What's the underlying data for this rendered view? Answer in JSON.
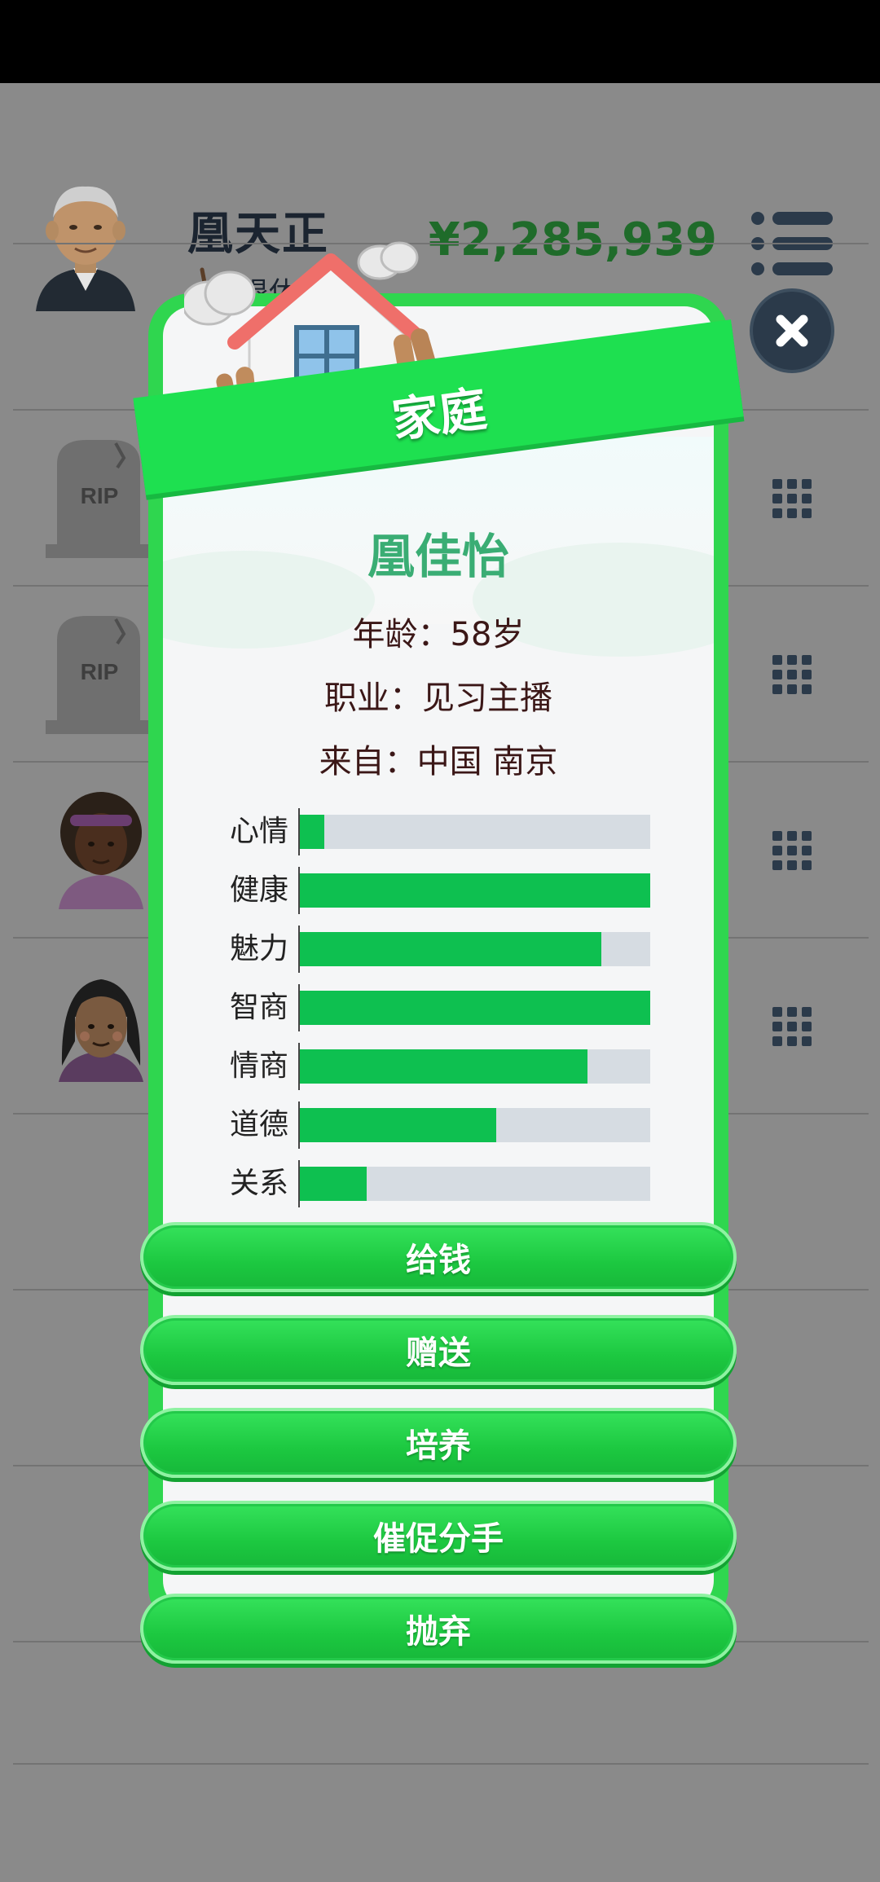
{
  "header": {
    "player_name": "凰天正",
    "status_label": "退休",
    "money": "¥2,285,939"
  },
  "rows": [
    {
      "icon": "tombstone-icon",
      "tombstone_text": "RIP"
    },
    {
      "icon": "tombstone-icon",
      "tombstone_text": "RIP"
    },
    {
      "icon": "avatar-woman-icon"
    },
    {
      "icon": "avatar-girl-icon"
    }
  ],
  "modal": {
    "title": "家庭",
    "name": "凰佳怡",
    "age_line": "年龄：58岁",
    "job_line": "职业：见习主播",
    "from_line": "来自：中国 南京",
    "stats": [
      {
        "label": "心情",
        "value": 0.07
      },
      {
        "label": "健康",
        "value": 1.0
      },
      {
        "label": "魅力",
        "value": 0.86
      },
      {
        "label": "智商",
        "value": 1.0
      },
      {
        "label": "情商",
        "value": 0.82
      },
      {
        "label": "道德",
        "value": 0.56
      },
      {
        "label": "关系",
        "value": 0.19
      }
    ],
    "actions": [
      {
        "label": "给钱"
      },
      {
        "label": "赠送"
      },
      {
        "label": "培养"
      },
      {
        "label": "催促分手"
      },
      {
        "label": "抛弃"
      }
    ]
  },
  "colors": {
    "modal_green": "#2fd64f",
    "bar_fill": "#0ec050",
    "bar_track": "#d6dce2",
    "name_green": "#3aad74",
    "money_green": "#1f6b2a",
    "overlay_gray": "#8a8a8a"
  }
}
